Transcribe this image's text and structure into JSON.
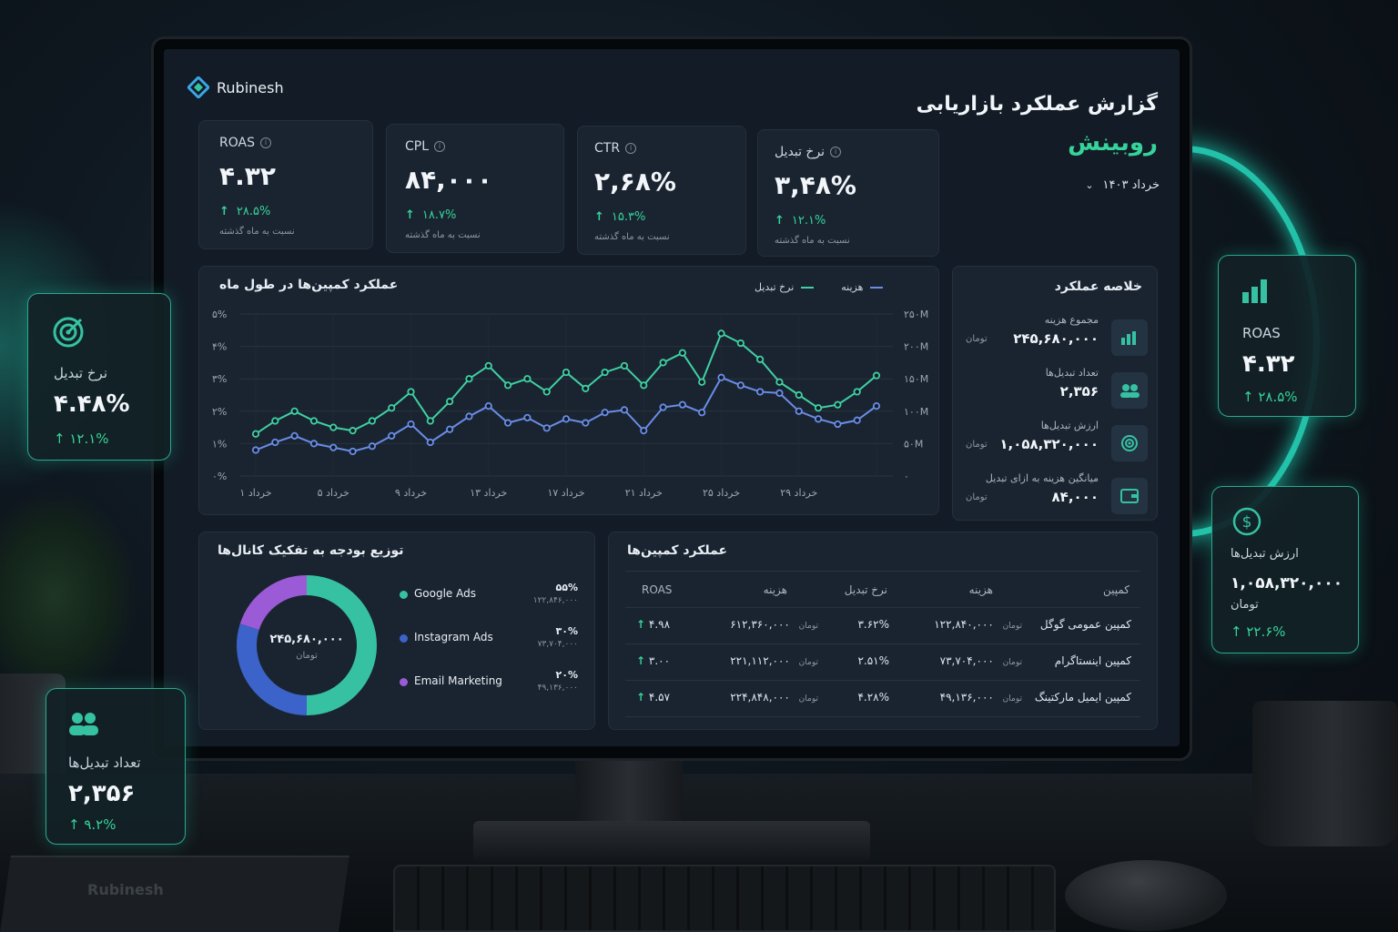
{
  "app": {
    "logo_text": "Rubinesh",
    "title": "گزارش عملکرد بازاریابی",
    "brand_fa": "روبینش",
    "date_filter": "خرداد ۱۴۰۳"
  },
  "kpis": [
    {
      "label": "ROAS",
      "value": "۴.۳۲",
      "change": "۲۸.۵%",
      "note": "نسبت به ماه گذشته"
    },
    {
      "label": "CPL",
      "value": "۸۴,۰۰۰",
      "change": "۱۸.۷%",
      "note": "نسبت به ماه گذشته"
    },
    {
      "label": "CTR",
      "value": "۲,۶۸%",
      "change": "۱۵.۳%",
      "note": "نسبت به ماه گذشته"
    },
    {
      "label": "نرخ تبدیل",
      "value": "۳,۴۸%",
      "change": "۱۲.۱%",
      "note": "نسبت به ماه گذشته"
    }
  ],
  "campaign_chart": {
    "title": "عملکرد کمپین‌ها در طول ماه",
    "legend_conversion": "نرخ تبدیل",
    "legend_cost": "هزینه"
  },
  "chart_data": {
    "type": "line",
    "title": "عملکرد کمپین‌ها در طول ماه",
    "x": [
      "۱ خرداد",
      "",
      "",
      "",
      "۵ خرداد",
      "",
      "",
      "",
      "۹ خرداد",
      "",
      "",
      "",
      "۱۳ خرداد",
      "",
      "",
      "",
      "۱۷ خرداد",
      "",
      "",
      "",
      "۲۱ خرداد",
      "",
      "",
      "",
      "۲۵ خرداد",
      "",
      "",
      "",
      "۲۹ خرداد",
      "",
      "",
      "",
      ""
    ],
    "x_tick_labels": [
      "۱ خرداد",
      "۵ خرداد",
      "۹ خرداد",
      "۱۳ خرداد",
      "۱۷ خرداد",
      "۲۱ خرداد",
      "۲۵ خرداد",
      "۲۹ خرداد"
    ],
    "y_left_ticks": [
      "۵%",
      "۴%",
      "۳%",
      "۲%",
      "۱%",
      "۰%"
    ],
    "y_right_ticks": [
      "۲۵۰M",
      "۲۰۰M",
      "۱۵۰M",
      "۱۰۰M",
      "۵۰M",
      "۰"
    ],
    "ylim_left": [
      0,
      5
    ],
    "ylim_right": [
      0,
      250
    ],
    "series": [
      {
        "name": "نرخ تبدیل",
        "axis": "left",
        "color": "#3fd1a4",
        "values": [
          1.3,
          1.7,
          2.0,
          1.7,
          1.5,
          1.4,
          1.7,
          2.1,
          2.6,
          1.7,
          2.3,
          3.0,
          3.4,
          2.8,
          3.0,
          2.6,
          3.2,
          2.7,
          3.2,
          3.4,
          2.8,
          3.5,
          3.8,
          2.9,
          4.4,
          4.1,
          3.6,
          2.9,
          2.5,
          2.1,
          2.2,
          2.6,
          3.1
        ]
      },
      {
        "name": "هزینه",
        "axis": "right",
        "color": "#6a8de8",
        "values": [
          40,
          52,
          62,
          50,
          44,
          38,
          46,
          62,
          80,
          52,
          72,
          92,
          108,
          82,
          90,
          74,
          88,
          82,
          98,
          102,
          70,
          106,
          110,
          98,
          152,
          140,
          130,
          128,
          100,
          88,
          80,
          86,
          108
        ]
      }
    ]
  },
  "summary": {
    "title": "خلاصه عملکرد",
    "items": [
      {
        "label": "مجموع هزینه",
        "value": "۲۴۵,۶۸۰,۰۰۰",
        "unit": "تومان",
        "icon": "bar-chart-icon"
      },
      {
        "label": "تعداد تبدیل‌ها",
        "value": "۲,۳۵۶",
        "unit": "",
        "icon": "users-icon"
      },
      {
        "label": "ارزش تبدیل‌ها",
        "value": "۱,۰۵۸,۳۲۰,۰۰۰",
        "unit": "تومان",
        "icon": "target-icon"
      },
      {
        "label": "میانگین هزینه به ازای تبدیل",
        "value": "۸۴,۰۰۰",
        "unit": "تومان",
        "icon": "wallet-icon"
      }
    ]
  },
  "budget": {
    "title": "توزیع بودجه به تفکیک کانال‌ها",
    "center_value": "۲۴۵,۶۸۰,۰۰۰",
    "center_unit": "تومان",
    "channels": [
      {
        "name": "Google Ads",
        "percent": "۵۵%",
        "amount": "۱۲۲,۸۴۶,۰۰۰",
        "color": "#36c2a2",
        "share": 0.5
      },
      {
        "name": "Instagram Ads",
        "percent": "۳۰%",
        "amount": "۷۳,۷۰۴,۰۰۰",
        "color": "#3b63c9",
        "share": 0.3
      },
      {
        "name": "Email Marketing",
        "percent": "۲۰%",
        "amount": "۴۹,۱۳۶,۰۰۰",
        "color": "#9b5ad6",
        "share": 0.2
      }
    ]
  },
  "campaigns": {
    "title": "عملکرد کمپین‌ها",
    "headers": {
      "campaign": "کمپین",
      "cost": "هزینه",
      "conversion_rate": "نرخ تبدیل",
      "revenue": "هزینه",
      "roas": "ROAS"
    },
    "unit": "تومان",
    "rows": [
      {
        "name": "کمپین عمومی گوگل",
        "cost": "۱۲۲,۸۴۰,۰۰۰",
        "conversion_rate": "۳.۶۲%",
        "revenue": "۶۱۲,۳۶۰,۰۰۰",
        "roas": "۴.۹۸"
      },
      {
        "name": "کمپین اینستاگرام",
        "cost": "۷۳,۷۰۴,۰۰۰",
        "conversion_rate": "۲.۵۱%",
        "revenue": "۲۲۱,۱۱۲,۰۰۰",
        "roas": "۳.۰۰"
      },
      {
        "name": "کمپین ایمیل مارکتینگ",
        "cost": "۴۹,۱۳۶,۰۰۰",
        "conversion_rate": "۴.۲۸%",
        "revenue": "۲۲۴,۸۴۸,۰۰۰",
        "roas": "۴.۵۷"
      }
    ]
  },
  "floating": {
    "conversion": {
      "label": "نرخ تبدیل",
      "value": "۴.۴۸%",
      "change": "۱۲.۱%"
    },
    "conversions_count": {
      "label": "تعداد تبدیل‌ها",
      "value": "۲,۳۵۶",
      "change": "۹.۲%"
    },
    "roas": {
      "label": "ROAS",
      "value": "۴.۳۲",
      "change": "۲۸.۵%"
    },
    "conversion_value": {
      "label": "ارزش تبدیل‌ها",
      "value": "۱,۰۵۸,۳۲۰,۰۰۰",
      "unit": "تومان",
      "change": "۲۲.۶%"
    }
  },
  "decor": {
    "notebook_logo": "Rubinesh"
  }
}
